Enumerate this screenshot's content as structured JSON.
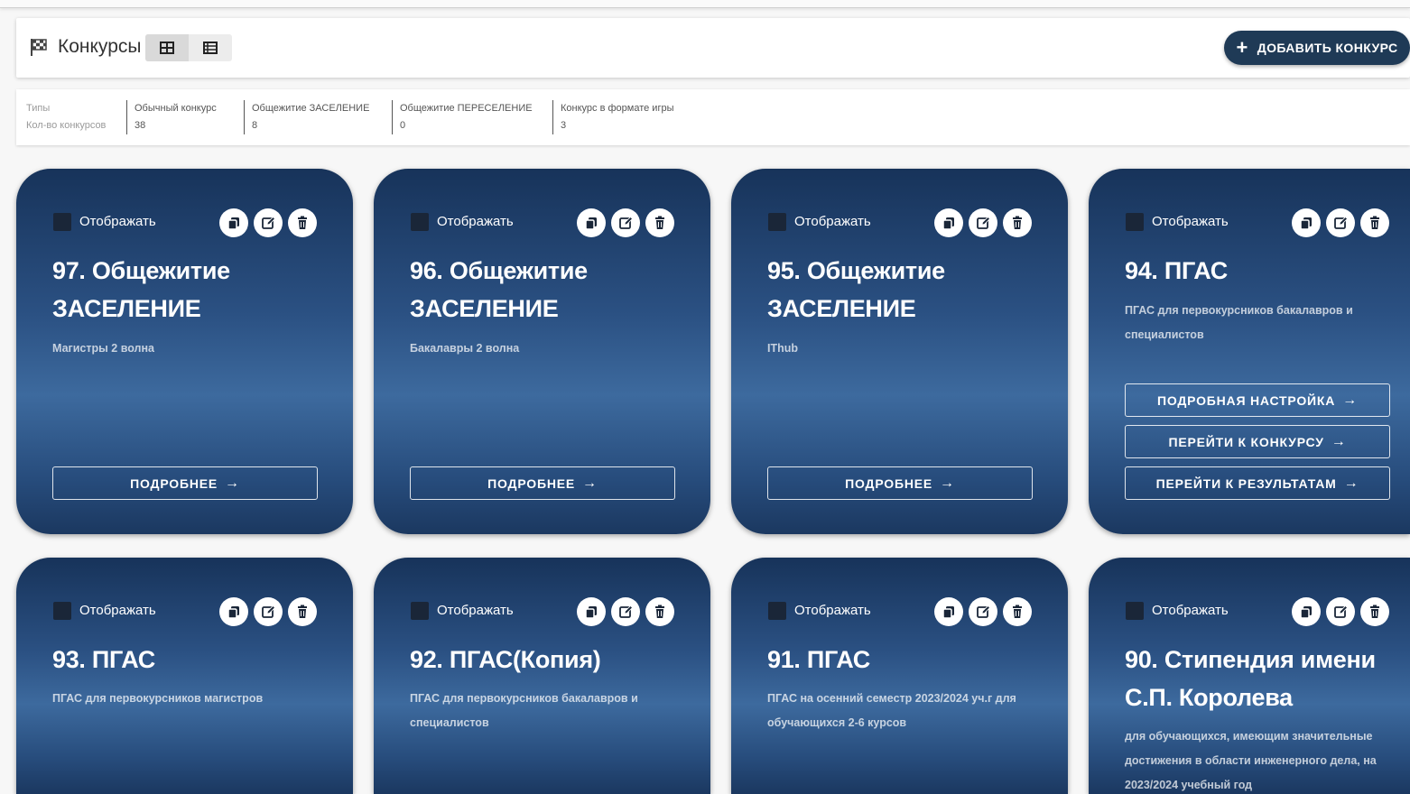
{
  "header": {
    "title": "Конкурсы",
    "add_button": "ДОБАВИТЬ КОНКУРС"
  },
  "stats": {
    "row_label_types": "Типы",
    "row_label_count": "Кол-во конкурсов",
    "types": [
      {
        "name": "Обычный конкурс",
        "count": "38"
      },
      {
        "name": "Общежитие ЗАСЕЛЕНИЕ",
        "count": "8"
      },
      {
        "name": "Общежитие ПЕРЕСЕЛЕНИЕ",
        "count": "0"
      },
      {
        "name": "Конкурс в формате игры",
        "count": "3"
      }
    ]
  },
  "cards": [
    {
      "show_label": "Отображать",
      "title": "97. Общежитие ЗАСЕЛЕНИЕ",
      "desc": "Магистры 2 волна",
      "buttons": [
        "ПОДРОБНЕЕ"
      ]
    },
    {
      "show_label": "Отображать",
      "title": "96. Общежитие ЗАСЕЛЕНИЕ",
      "desc": "Бакалавры 2 волна",
      "buttons": [
        "ПОДРОБНЕЕ"
      ]
    },
    {
      "show_label": "Отображать",
      "title": "95. Общежитие ЗАСЕЛЕНИЕ",
      "desc": "IThub",
      "buttons": [
        "ПОДРОБНЕЕ"
      ]
    },
    {
      "show_label": "Отображать",
      "title": "94. ПГАС",
      "desc": "ПГАС для первокурсников бакалавров и специалистов",
      "buttons": [
        "ПОДРОБНАЯ НАСТРОЙКА",
        "ПЕРЕЙТИ К КОНКУРСУ",
        "ПЕРЕЙТИ К РЕЗУЛЬТАТАМ"
      ]
    },
    {
      "show_label": "Отображать",
      "title": "93. ПГАС",
      "desc": "ПГАС для первокурсников магистров",
      "buttons": []
    },
    {
      "show_label": "Отображать",
      "title": "92. ПГАС(Копия)",
      "desc": "ПГАС для первокурсников бакалавров и специалистов",
      "buttons": []
    },
    {
      "show_label": "Отображать",
      "title": "91. ПГАС",
      "desc": "ПГАС на осенний семестр 2023/2024 уч.г для обучающихся 2-6 курсов",
      "buttons": []
    },
    {
      "show_label": "Отображать",
      "title": "90. Стипендия имени С.П. Королева",
      "desc": "для обучающихся, имеющим значительные достижения в области инженерного дела, на 2023/2024 учебный год",
      "buttons": []
    }
  ],
  "colors": {
    "primary": "#1f3a56",
    "card_top": "#17335a",
    "card_mid": "#3d6a9e"
  },
  "icons": [
    "flag-icon",
    "grid-view-icon",
    "list-view-icon",
    "plus-icon",
    "copy-icon",
    "edit-icon",
    "delete-icon",
    "arrow-right-icon"
  ]
}
